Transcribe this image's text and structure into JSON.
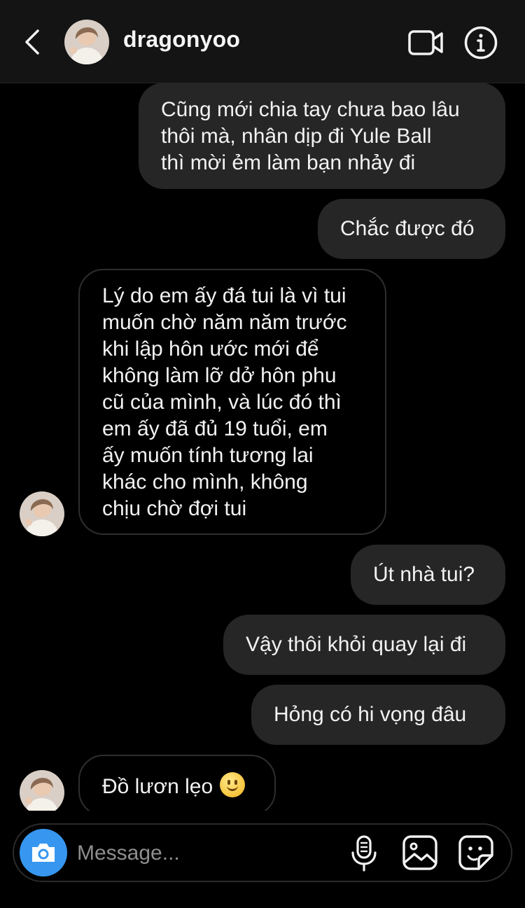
{
  "header": {
    "username": "dragonyoo",
    "back_icon": "chevron-left-icon",
    "video_icon": "video-camera-icon",
    "info_icon": "info-icon"
  },
  "messages": [
    {
      "side": "sent",
      "lines": [
        "Cũng mới chia tay chưa bao lâu",
        "thôi mà, nhân dịp đi Yule Ball",
        "thì mời ẻm làm bạn nhảy đi"
      ]
    },
    {
      "side": "sent",
      "lines": [
        "Chắc được đó"
      ]
    },
    {
      "side": "received",
      "lines": [
        "Lý do em ấy đá tui là vì tui",
        "muốn chờ năm năm trước",
        "khi lập hôn ước mới để",
        "không làm lỡ dở hôn phu",
        "cũ của mình, và lúc đó thì",
        "em ấy đã đủ 19 tuổi, em",
        "ấy muốn tính tương lai",
        "khác cho mình, không",
        "chịu chờ đợi tui"
      ]
    },
    {
      "side": "sent",
      "lines": [
        "Út nhà tui?"
      ]
    },
    {
      "side": "sent",
      "lines": [
        "Vậy thôi khỏi quay lại đi"
      ]
    },
    {
      "side": "sent",
      "lines": [
        "Hỏng có hi vọng đâu"
      ]
    },
    {
      "side": "received",
      "lines": [
        "Đồ lươn lẹo"
      ],
      "emoji": "slightly-smiling-face-emoji"
    }
  ],
  "composer": {
    "placeholder": "Message...",
    "camera_icon": "camera-icon",
    "mic_icon": "microphone-icon",
    "gallery_icon": "image-icon",
    "sticker_icon": "sticker-icon",
    "accent_color": "#3797f0"
  },
  "colors": {
    "background": "#000000",
    "header_bg": "#141414",
    "sent_bubble": "#262626",
    "received_border": "#2e2e2e",
    "text": "#f2f2f2"
  }
}
